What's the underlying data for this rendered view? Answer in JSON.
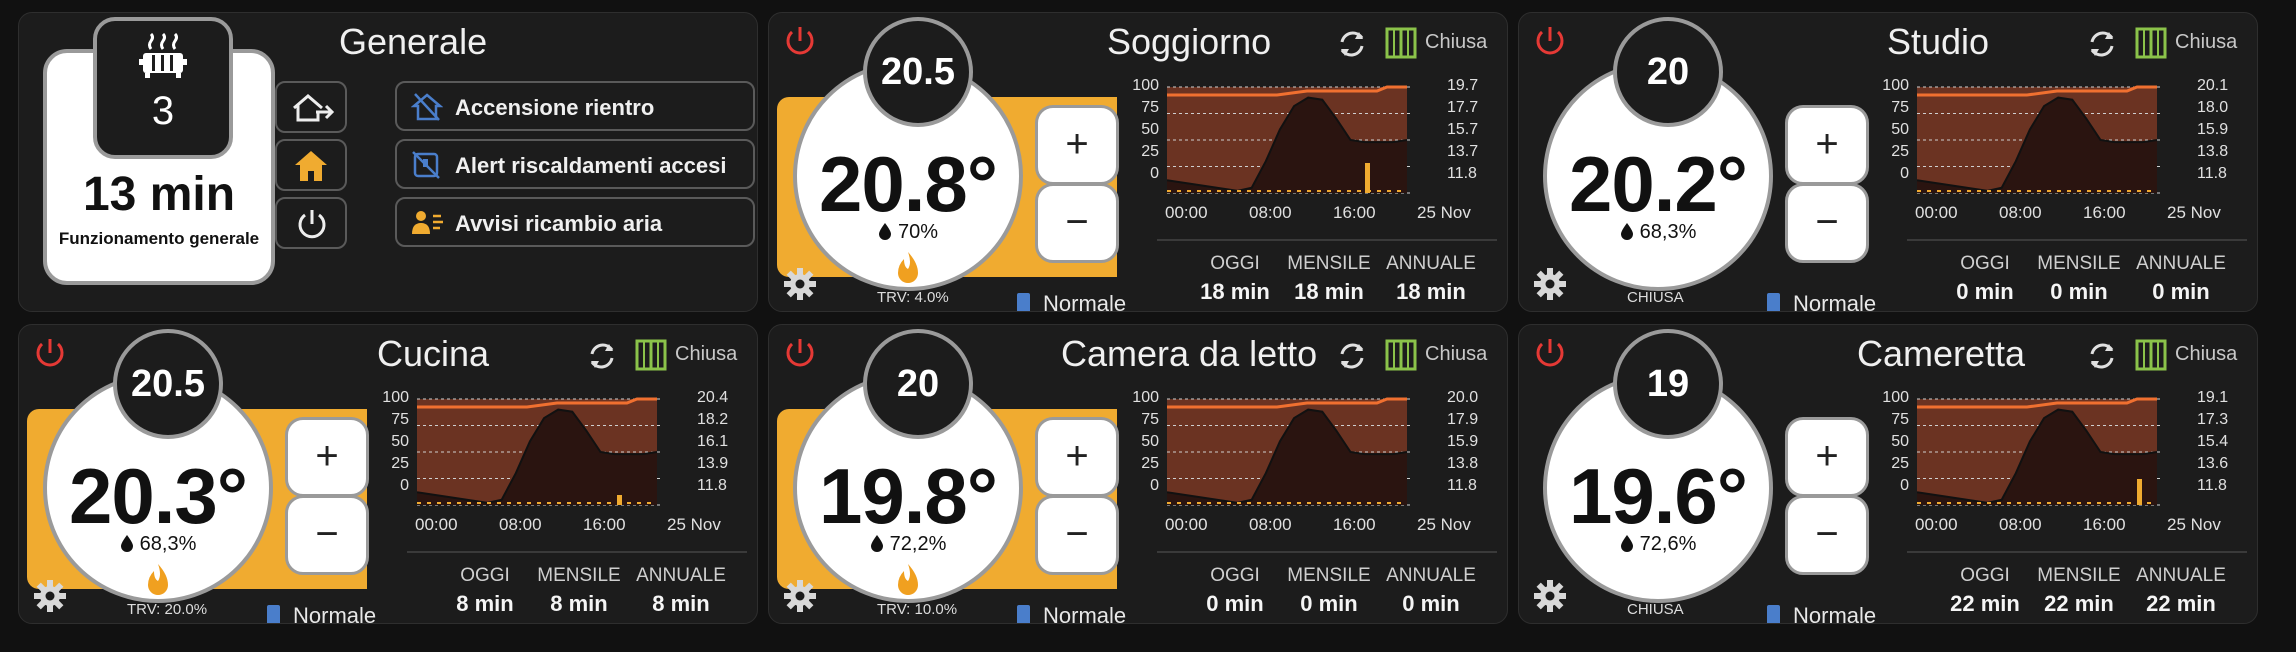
{
  "general": {
    "title": "Generale",
    "heater_count": "3",
    "runtime": "13 min",
    "runtime_label": "Funzionamento generale",
    "buttons": [
      {
        "label": "Accensione rientro",
        "icon": "home-off-icon"
      },
      {
        "label": "Alert riscaldamenti accesi",
        "icon": "thermostat-alert-icon"
      },
      {
        "label": "Avvisi ricambio aria",
        "icon": "people-air-icon"
      }
    ],
    "side_icons": [
      "home-away-icon",
      "home-icon",
      "power-icon"
    ]
  },
  "labels": {
    "today": "OGGI",
    "month": "MENSILE",
    "year": "ANNUALE",
    "closed": "Chiusa",
    "mode": "Normale"
  },
  "x_ticks": [
    "00:00",
    "08:00",
    "16:00",
    "25 Nov"
  ],
  "y_ticks_left": [
    "100",
    "75",
    "50",
    "25",
    "0"
  ],
  "colors": {
    "accent": "#f0ab30",
    "power": "#e53935",
    "door": "#8bc34a",
    "battery": "#4a7ecb"
  },
  "rooms": [
    {
      "name": "Soggiorno",
      "setpoint": "20.5",
      "temp": "20.8°",
      "humidity": "70%",
      "heating": true,
      "trv": "TRV: 4.0%",
      "today": "18 min",
      "month": "18 min",
      "year": "18 min",
      "y_right": [
        "19.7",
        "17.7",
        "15.7",
        "13.7",
        "11.8"
      ]
    },
    {
      "name": "Studio",
      "setpoint": "20",
      "temp": "20.2°",
      "humidity": "68,3%",
      "heating": false,
      "trv": "CHIUSA",
      "today": "0 min",
      "month": "0 min",
      "year": "0 min",
      "y_right": [
        "20.1",
        "18.0",
        "15.9",
        "13.8",
        "11.8"
      ]
    },
    {
      "name": "Cucina",
      "setpoint": "20.5",
      "temp": "20.3°",
      "humidity": "68,3%",
      "heating": true,
      "trv": "TRV: 20.0%",
      "today": "8 min",
      "month": "8 min",
      "year": "8 min",
      "y_right": [
        "20.4",
        "18.2",
        "16.1",
        "13.9",
        "11.8"
      ]
    },
    {
      "name": "Camera da letto",
      "setpoint": "20",
      "temp": "19.8°",
      "humidity": "72,2%",
      "heating": true,
      "trv": "TRV: 10.0%",
      "today": "0 min",
      "month": "0 min",
      "year": "0 min",
      "y_right": [
        "20.0",
        "17.9",
        "15.9",
        "13.8",
        "11.8"
      ]
    },
    {
      "name": "Cameretta",
      "setpoint": "19",
      "temp": "19.6°",
      "humidity": "72,6%",
      "heating": false,
      "trv": "CHIUSA",
      "today": "22 min",
      "month": "22 min",
      "year": "22 min",
      "y_right": [
        "19.1",
        "17.3",
        "15.4",
        "13.6",
        "11.8"
      ]
    }
  ]
}
